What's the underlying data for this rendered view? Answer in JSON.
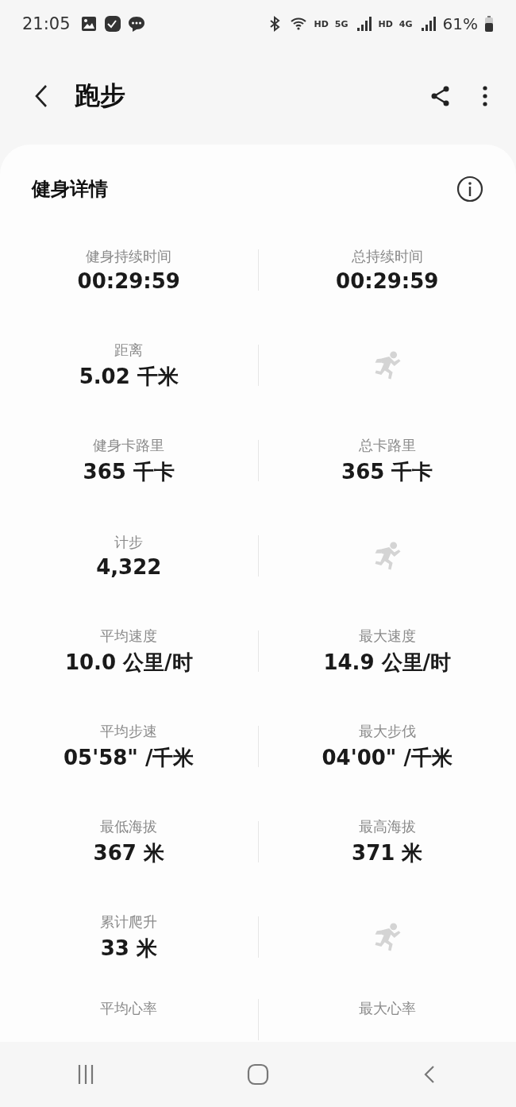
{
  "status_bar": {
    "time": "21:05",
    "network_labels": [
      "HD",
      "5G",
      "HD",
      "4G"
    ],
    "battery": "61%"
  },
  "header": {
    "title": "跑步"
  },
  "card": {
    "title": "健身详情",
    "rows": [
      [
        {
          "kind": "metric",
          "label": "健身持续时间",
          "value": "00:29:59"
        },
        {
          "kind": "metric",
          "label": "总持续时间",
          "value": "00:29:59"
        }
      ],
      [
        {
          "kind": "metric",
          "label": "距离",
          "value": "5.02 千米"
        },
        {
          "kind": "icon"
        }
      ],
      [
        {
          "kind": "metric",
          "label": "健身卡路里",
          "value": "365 千卡"
        },
        {
          "kind": "metric",
          "label": "总卡路里",
          "value": "365 千卡"
        }
      ],
      [
        {
          "kind": "metric",
          "label": "计步",
          "value": "4,322"
        },
        {
          "kind": "icon"
        }
      ],
      [
        {
          "kind": "metric",
          "label": "平均速度",
          "value": "10.0 公里/时"
        },
        {
          "kind": "metric",
          "label": "最大速度",
          "value": "14.9 公里/时"
        }
      ],
      [
        {
          "kind": "metric",
          "label": "平均步速",
          "value": "05'58\" /千米"
        },
        {
          "kind": "metric",
          "label": "最大步伐",
          "value": "04'00\" /千米"
        }
      ],
      [
        {
          "kind": "metric",
          "label": "最低海拔",
          "value": "367 米"
        },
        {
          "kind": "metric",
          "label": "最高海拔",
          "value": "371 米"
        }
      ],
      [
        {
          "kind": "metric",
          "label": "累计爬升",
          "value": "33 米"
        },
        {
          "kind": "icon"
        }
      ],
      [
        {
          "kind": "metric",
          "label": "平均心率"
        },
        {
          "kind": "metric",
          "label": "最大心率"
        }
      ]
    ]
  }
}
